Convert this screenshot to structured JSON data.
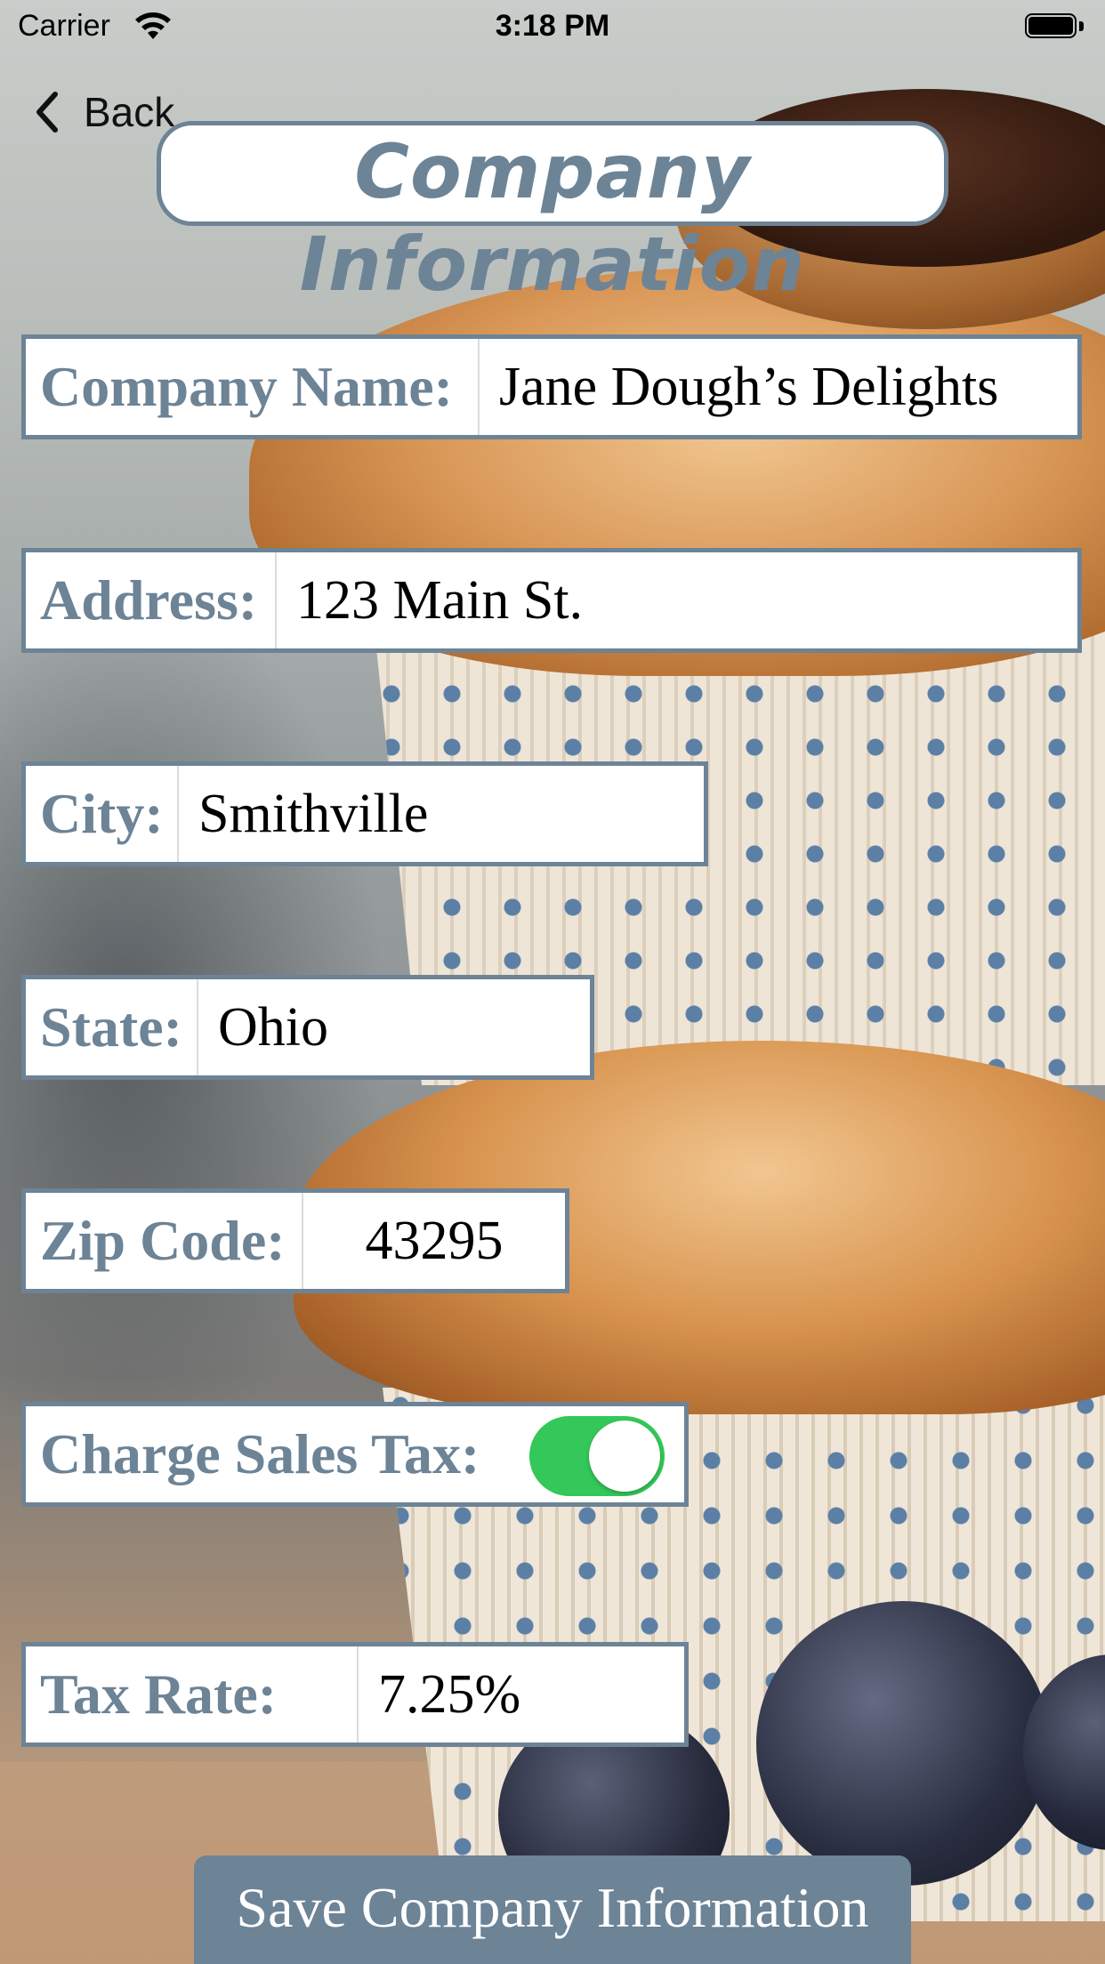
{
  "status_bar": {
    "carrier": "Carrier",
    "time": "3:18 PM"
  },
  "nav": {
    "back_label": "Back"
  },
  "page_title": "Company Information",
  "form": {
    "company_name": {
      "label": "Company Name:",
      "value": "Jane Dough’s Delights"
    },
    "address": {
      "label": "Address:",
      "value": "123 Main St."
    },
    "city": {
      "label": "City:",
      "value": "Smithville"
    },
    "state": {
      "label": "State:",
      "value": "Ohio"
    },
    "zip_code": {
      "label": "Zip Code:",
      "value": "43295"
    },
    "charge_sales_tax": {
      "label": "Charge Sales Tax:",
      "on": true
    },
    "tax_rate": {
      "label": "Tax Rate:",
      "value": "7.25%"
    }
  },
  "save_button_label": "Save Company Information",
  "colors": {
    "accent": "#6d8396",
    "toggle_on": "#34c759",
    "field_bg": "#ffffff"
  },
  "icons": {
    "back": "chevron-left-icon",
    "wifi": "wifi-icon",
    "battery": "battery-icon"
  }
}
